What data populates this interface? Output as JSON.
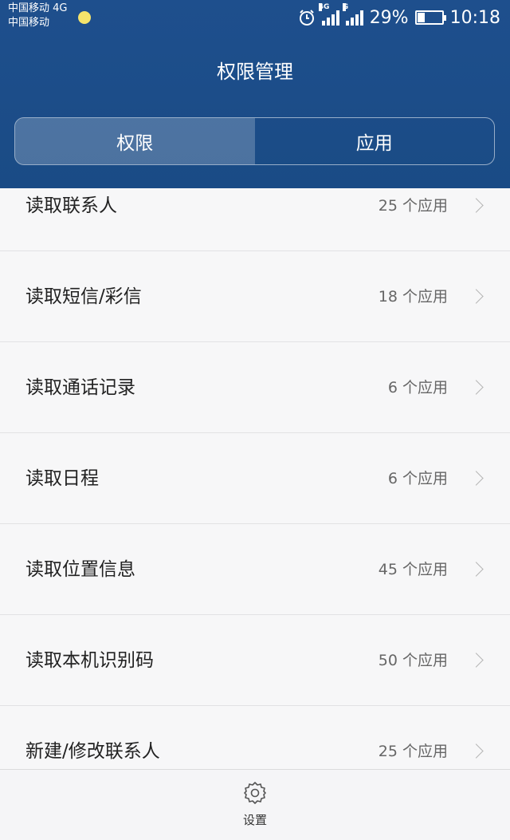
{
  "status_bar": {
    "carrier_line1": "中国移动 4G",
    "carrier_line2": "中国移动",
    "signal1_tag": "4G",
    "signal2_tag": "G",
    "battery_percent": "29%",
    "battery_level": 0.29,
    "time": "10:18"
  },
  "header": {
    "title": "权限管理"
  },
  "tabs": [
    {
      "label": "权限",
      "active": true
    },
    {
      "label": "应用",
      "active": false
    }
  ],
  "permissions": [
    {
      "label": "读取联系人",
      "count": "25 个应用"
    },
    {
      "label": "读取短信/彩信",
      "count": "18 个应用"
    },
    {
      "label": "读取通话记录",
      "count": "6 个应用"
    },
    {
      "label": "读取日程",
      "count": "6 个应用"
    },
    {
      "label": "读取位置信息",
      "count": "45 个应用"
    },
    {
      "label": "读取本机识别码",
      "count": "50 个应用"
    },
    {
      "label": "新建/修改联系人",
      "count": "25 个应用"
    }
  ],
  "bottom_bar": {
    "settings_label": "设置",
    "settings_icon": "gear-icon"
  },
  "colors": {
    "header_bg": "#1e4f8d",
    "list_bg": "#f7f7f8"
  }
}
